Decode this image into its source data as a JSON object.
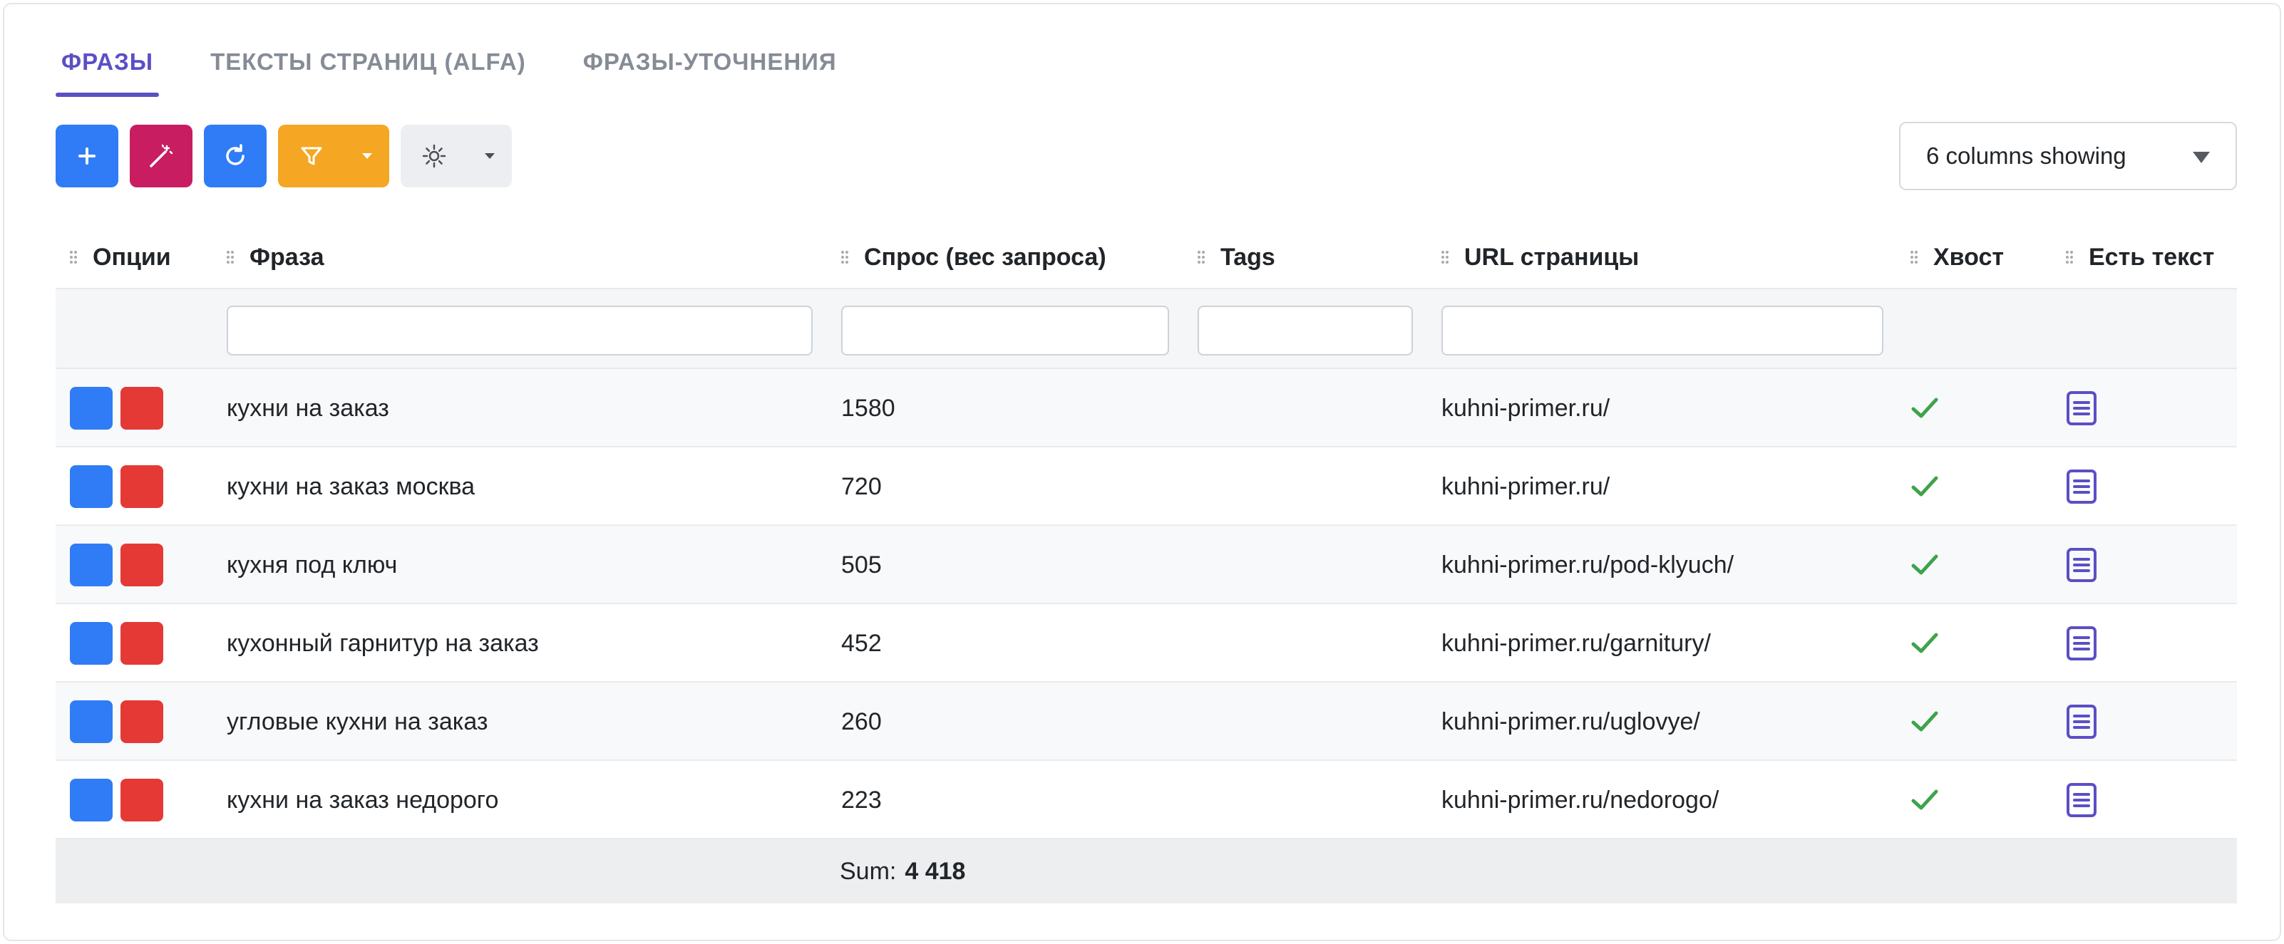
{
  "tabs": [
    {
      "label": "ФРАЗЫ",
      "active": true
    },
    {
      "label": "ТЕКСТЫ СТРАНИЦ (ALFA)",
      "active": false
    },
    {
      "label": "ФРАЗЫ-УТОЧНЕНИЯ",
      "active": false
    }
  ],
  "toolbar": {
    "add_icon": "plus-icon",
    "wand_icon": "magic-wand-icon",
    "refresh_icon": "refresh-icon",
    "filter_icon": "filter-icon",
    "settings_icon": "gear-icon",
    "columns_select": "6 columns showing",
    "colors": {
      "primary": "#2f7cf6",
      "magenta": "#c81d61",
      "orange": "#f5a623",
      "accent": "#5b4fc6"
    }
  },
  "columns": [
    {
      "key": "options",
      "label": "Опции"
    },
    {
      "key": "phrase",
      "label": "Фраза"
    },
    {
      "key": "demand",
      "label": "Спрос (вес запроса)"
    },
    {
      "key": "tags",
      "label": "Tags"
    },
    {
      "key": "url",
      "label": "URL страницы"
    },
    {
      "key": "tail",
      "label": "Хвост"
    },
    {
      "key": "has_text",
      "label": "Есть текст"
    }
  ],
  "rows": [
    {
      "phrase": "кухни на заказ",
      "demand": "1580",
      "tags": "",
      "url": "kuhni-primer.ru/",
      "tail": true,
      "has_text": true
    },
    {
      "phrase": "кухни на заказ москва",
      "demand": "720",
      "tags": "",
      "url": "kuhni-primer.ru/",
      "tail": true,
      "has_text": true
    },
    {
      "phrase": "кухня под ключ",
      "demand": "505",
      "tags": "",
      "url": "kuhni-primer.ru/pod-klyuch/",
      "tail": true,
      "has_text": true
    },
    {
      "phrase": "кухонный гарнитур на заказ",
      "demand": "452",
      "tags": "",
      "url": "kuhni-primer.ru/garnitury/",
      "tail": true,
      "has_text": true
    },
    {
      "phrase": "угловые кухни на заказ",
      "demand": "260",
      "tags": "",
      "url": "kuhni-primer.ru/uglovye/",
      "tail": true,
      "has_text": true
    },
    {
      "phrase": "кухни на заказ недорого",
      "demand": "223",
      "tags": "",
      "url": "kuhni-primer.ru/nedorogo/",
      "tail": true,
      "has_text": true
    }
  ],
  "footer": {
    "sum_label": "Sum:",
    "sum_value": "4 418"
  }
}
